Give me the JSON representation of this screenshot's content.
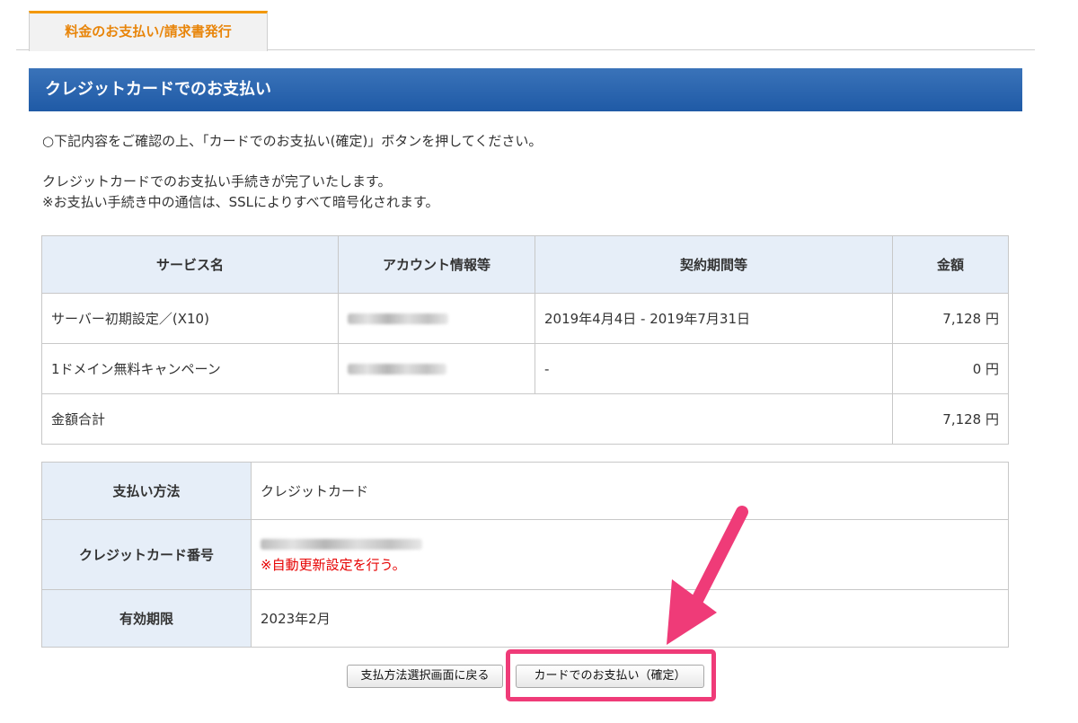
{
  "tab": {
    "label": "料金のお支払い/請求書発行"
  },
  "section": {
    "title": "クレジットカードでのお支払い"
  },
  "intro": {
    "line1": "○下記内容をご確認の上、「カードでのお支払い(確定)」ボタンを押してください。",
    "line2": "クレジットカードでのお支払い手続きが完了いたします。",
    "line3": "※お支払い手続き中の通信は、SSLによりすべて暗号化されます。"
  },
  "services": {
    "headers": [
      "サービス名",
      "アカウント情報等",
      "契約期間等",
      "金額"
    ],
    "rows": [
      {
        "name": "サーバー初期設定／(X10)",
        "period": "2019年4月4日 - 2019年7月31日",
        "amount": "7,128 円"
      },
      {
        "name": "1ドメイン無料キャンペーン",
        "period": "-",
        "amount": "0 円"
      }
    ],
    "total_label": "金額合計",
    "total_amount": "7,128 円"
  },
  "payment": {
    "method_label": "支払い方法",
    "method_value": "クレジットカード",
    "card_label": "クレジットカード番号",
    "card_notice": "※自動更新設定を行う。",
    "expiry_label": "有効期限",
    "expiry_value": "2023年2月"
  },
  "buttons": {
    "back": "支払方法選択画面に戻る",
    "confirm": "カードでのお支払い（確定）"
  },
  "colors": {
    "accent_orange": "#f39800",
    "header_blue": "#1f5aa6",
    "annotation_pink": "#ef3b78",
    "notice_red": "#e60000"
  }
}
